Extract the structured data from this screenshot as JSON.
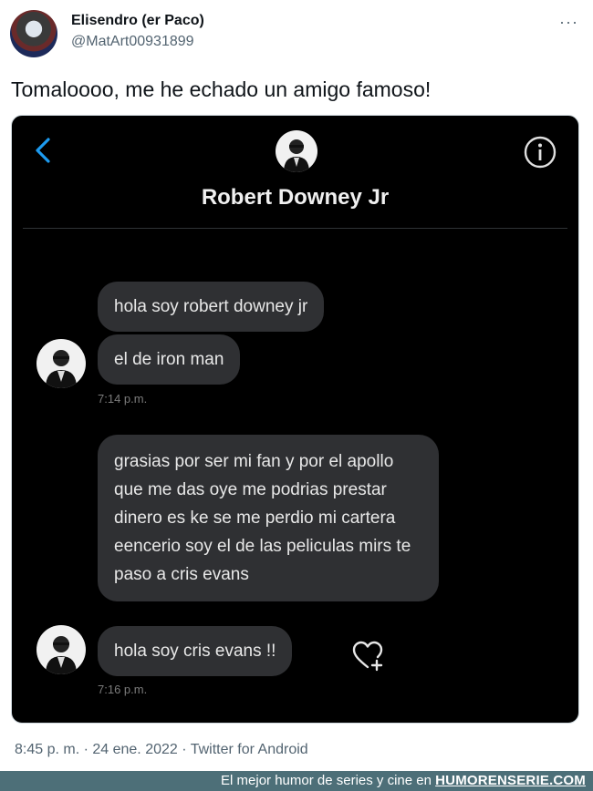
{
  "tweet": {
    "author_name": "Elisendro (er Paco)",
    "author_handle": "@MatArt00931899",
    "more_label": "···",
    "text": "Tomaloooo, me he echado un amigo famoso!",
    "meta": "8:45 p. m. · 24 ene. 2022 · Twitter for Android"
  },
  "dm": {
    "contact_name": "Robert Downey Jr",
    "messages": [
      {
        "text": "hola soy robert downey jr"
      },
      {
        "text": "el de iron man"
      },
      {
        "text": "grasias por ser mi fan y por el apollo que me das oye me podrias prestar dinero es ke se me perdio mi cartera eencerio soy el de las peliculas mirs te paso a cris evans"
      },
      {
        "text": "hola soy cris evans !!"
      }
    ],
    "timestamps": [
      "7:14 p.m.",
      "7:16 p.m."
    ],
    "icons": {
      "back": "chevron-left-icon",
      "info": "info-icon",
      "react": "heart-plus-icon"
    },
    "colors": {
      "accent": "#1d9bf0",
      "bubble": "#2f3033",
      "background": "#000000"
    }
  },
  "watermark": {
    "prefix": "El mejor humor de series y cine en",
    "site": "HUMORENSERIE.COM"
  }
}
